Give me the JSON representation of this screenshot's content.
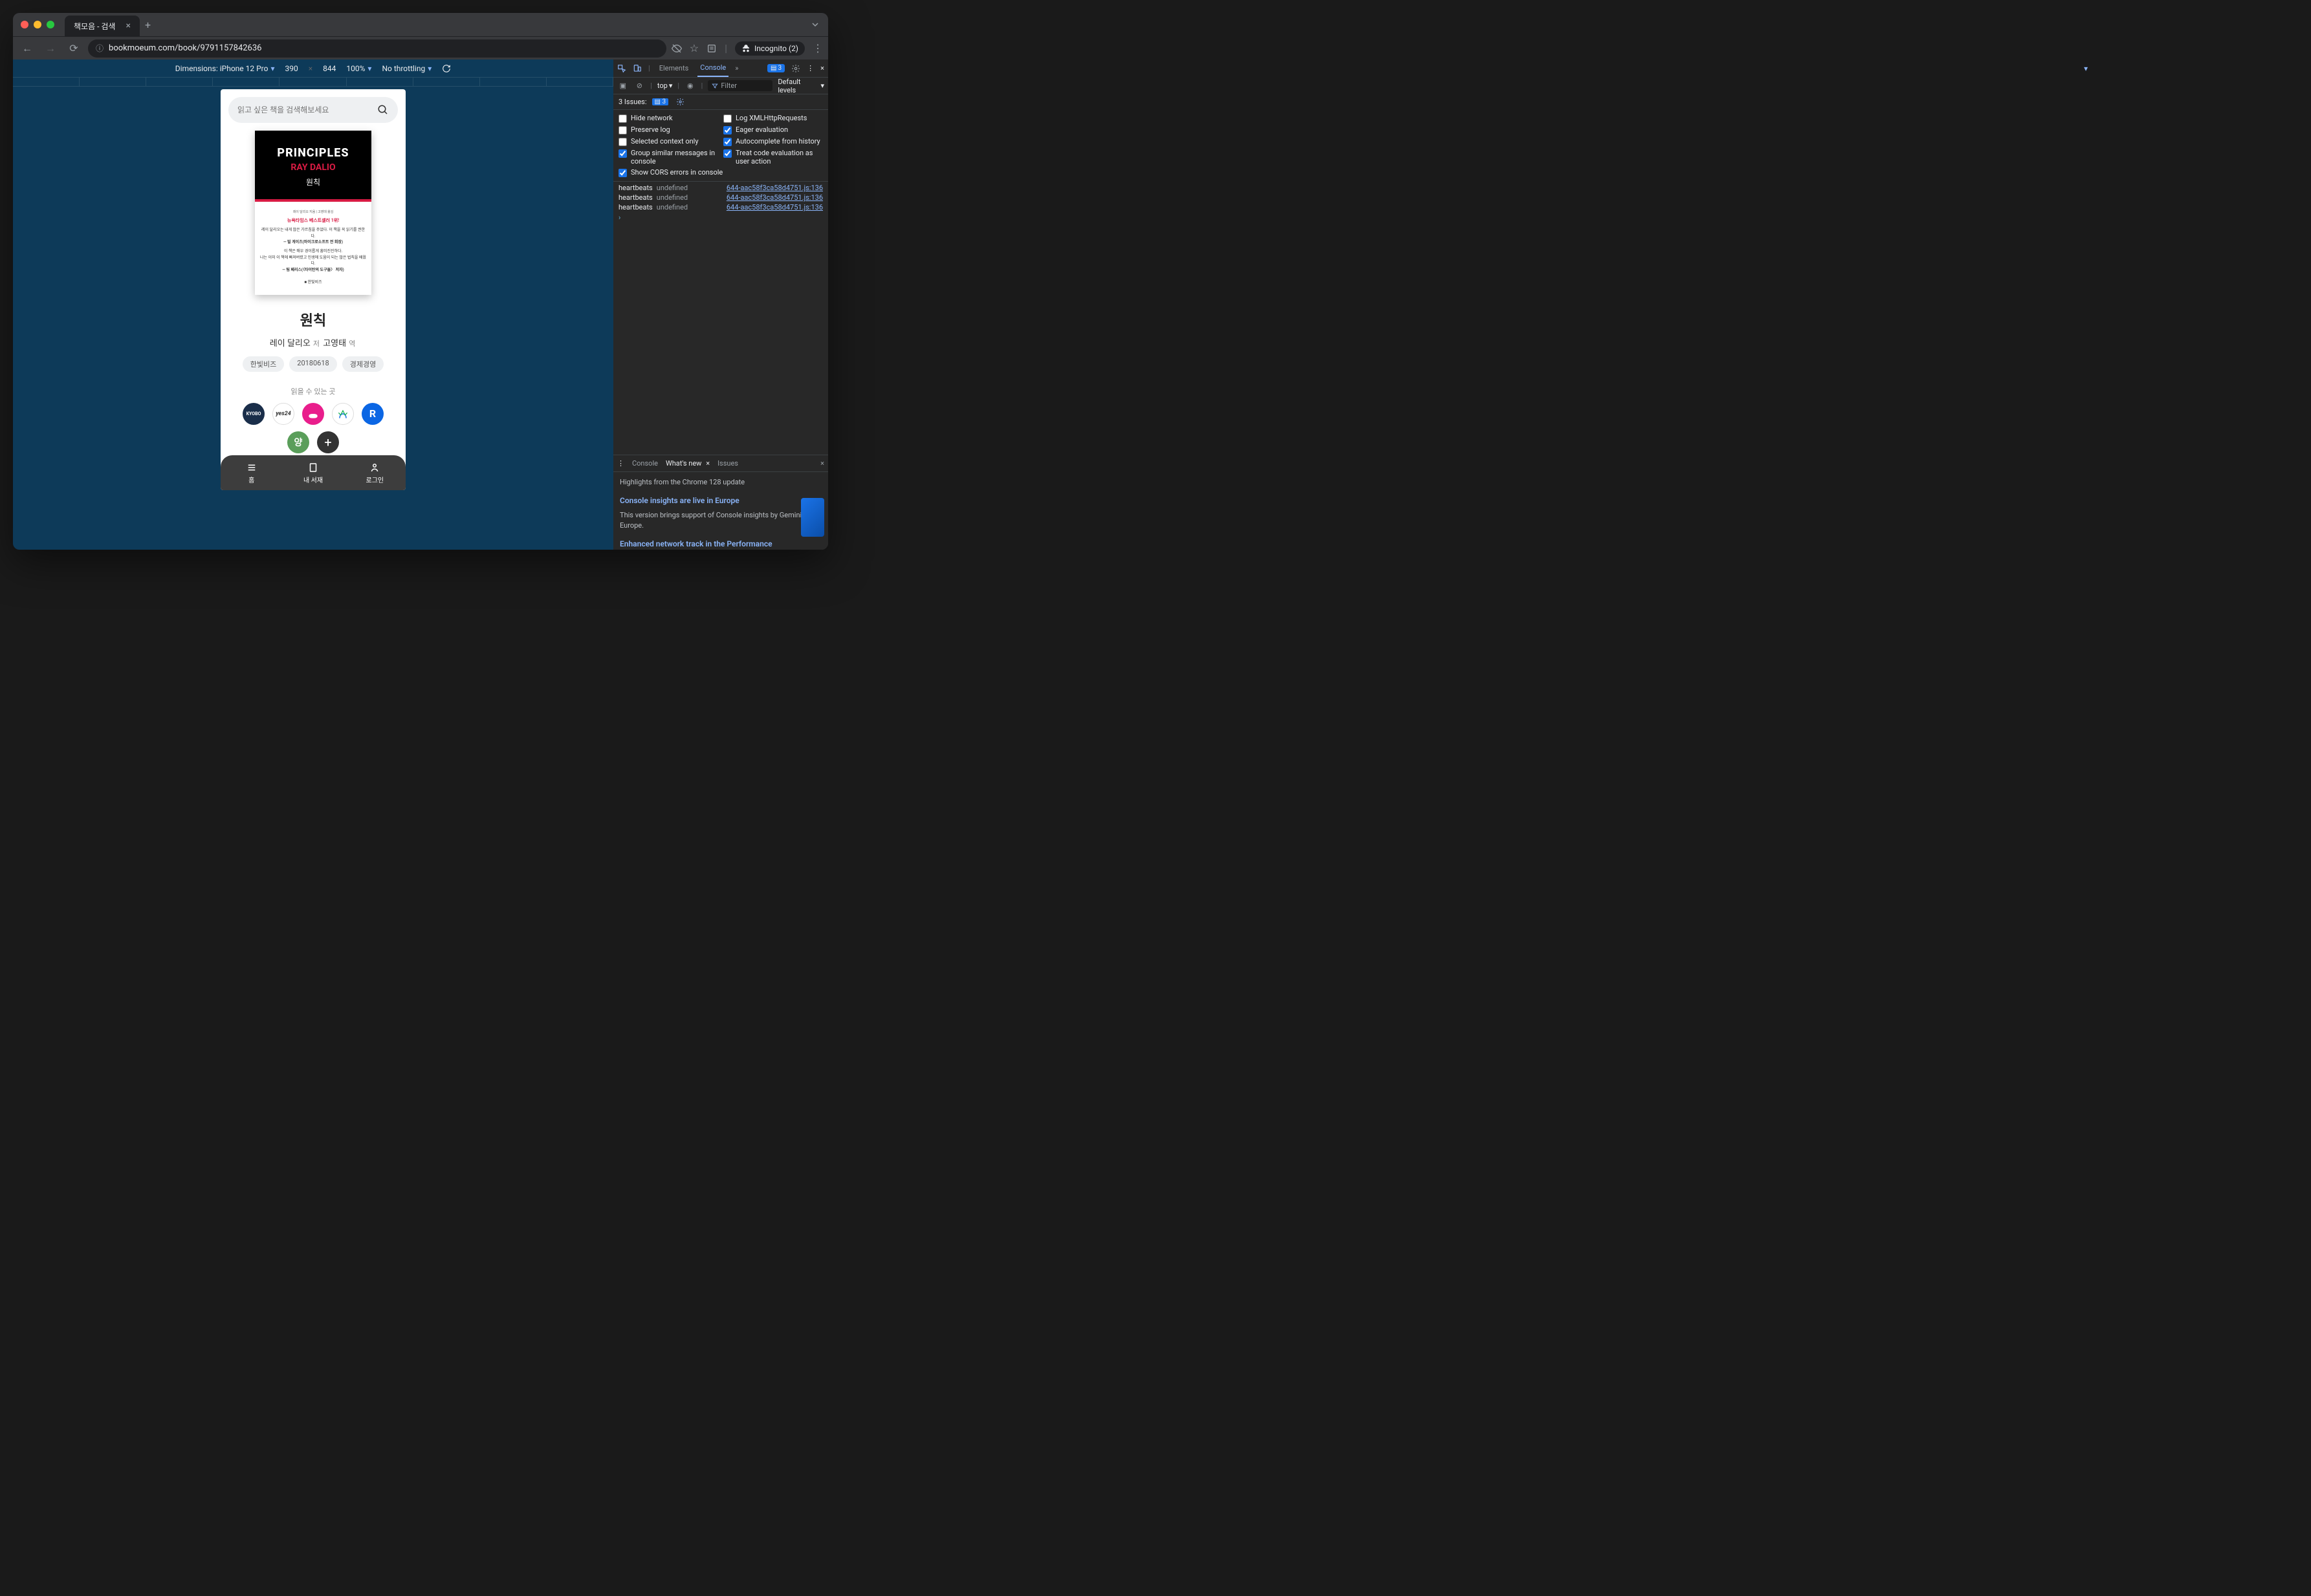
{
  "browser": {
    "tab_title": "책모음 - 검색",
    "url": "bookmoeum.com/book/9791157842636",
    "incognito_label": "Incognito (2)"
  },
  "device_toolbar": {
    "dimensions_label": "Dimensions: iPhone 12 Pro",
    "width": "390",
    "times": "×",
    "height": "844",
    "zoom": "100%",
    "throttling": "No throttling"
  },
  "phone": {
    "search_placeholder": "읽고 싶은 책을 검색해보세요",
    "cover": {
      "line1": "PRINCIPLES",
      "line2": "RAY DALIO",
      "line3": "원칙",
      "sub0": "레이 달리오 지음 | 고영태 옮김",
      "sub1": "뉴욕타임스 베스트셀러 1위!",
      "sub2a": "레이 달리오는 내게 많은 가르침을 주었다. 이 책을 꼭 읽기를 권한다.",
      "sub2b": "— 빌 게이츠(마이크로소프트 전 회장)",
      "sub3a": "이 책은 매우 경이롭게 흥미진진하다.",
      "sub3b": "나는 이미 이 책에 빠져버렸고 인생에 도움이 되는 많은 법칙을 배웠다.",
      "sub3c": "— 팀 페리스(〈타이탄의 도구들〉 저자)",
      "publisher": "■ 한빛비즈"
    },
    "title": "원칙",
    "author": "레이 달리오",
    "author_suffix": "저",
    "translator": "고영태",
    "translator_suffix": "역",
    "tags": [
      "한빛비즈",
      "20180618",
      "경제경영"
    ],
    "read_at": "읽을 수 있는 곳",
    "stores": [
      "KYOBO",
      "yes24",
      "",
      "",
      "R"
    ],
    "stores2": [
      "양",
      "+"
    ],
    "nav": [
      "홈",
      "내 서재",
      "로그인"
    ]
  },
  "devtools": {
    "tabs": {
      "elements": "Elements",
      "console": "Console"
    },
    "badge_count": "3",
    "filter_placeholder": "Filter",
    "top_label": "top",
    "levels": "Default levels",
    "issues_label": "3 Issues:",
    "issues_count": "3",
    "checks": {
      "hide_network": "Hide network",
      "log_xhr": "Log XMLHttpRequests",
      "preserve": "Preserve log",
      "eager": "Eager evaluation",
      "selected_ctx": "Selected context only",
      "autocomplete": "Autocomplete from history",
      "group": "Group similar messages in console",
      "treat_eval": "Treat code evaluation as user action",
      "cors": "Show CORS errors in console"
    },
    "logs": [
      {
        "key": "heartbeats",
        "val": "undefined",
        "src": "644-aac58f3ca58d4751.js:136"
      },
      {
        "key": "heartbeats",
        "val": "undefined",
        "src": "644-aac58f3ca58d4751.js:136"
      },
      {
        "key": "heartbeats",
        "val": "undefined",
        "src": "644-aac58f3ca58d4751.js:136"
      }
    ],
    "drawer": {
      "tabs": {
        "console": "Console",
        "whatsnew": "What's new",
        "issues": "Issues"
      },
      "highlight": "Highlights from the Chrome 128 update",
      "h1": "Console insights are live in Europe",
      "b1": "This version brings support of Console insights by Gemini to Europe.",
      "h2": "Enhanced network track in the Performance"
    }
  }
}
